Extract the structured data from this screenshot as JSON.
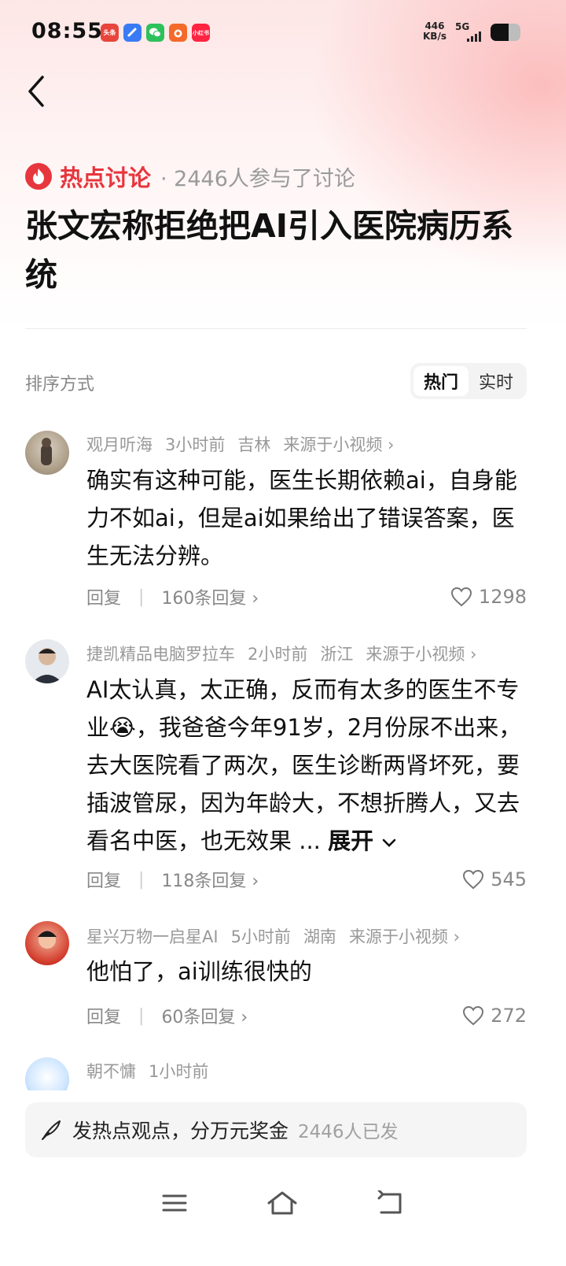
{
  "status": {
    "time": "08:55",
    "apps": [
      {
        "name": "toutiao-app-icon",
        "label": "头条",
        "color": "#e8453c"
      },
      {
        "name": "blue-app-icon",
        "label": "",
        "color": "#3a7bf5"
      },
      {
        "name": "wechat-icon",
        "label": "",
        "color": "#2dc15b"
      },
      {
        "name": "orange-app-icon",
        "label": "",
        "color": "#f46a2a"
      },
      {
        "name": "xiaohongshu-icon",
        "label": "小红书",
        "color": "#ff2442"
      }
    ],
    "net_speed_value": "446",
    "net_speed_unit": "KB/s",
    "network": "5G",
    "battery_level": 0.6
  },
  "header": {
    "topic_label": "热点讨论",
    "participant_text": "· 2446人参与了讨论",
    "title": "张文宏称拒绝把AI引入医院病历系统"
  },
  "sort": {
    "label": "排序方式",
    "options": [
      "热门",
      "实时"
    ],
    "active": "热门"
  },
  "comments": [
    {
      "user": "观月听海",
      "time": "3小时前",
      "location": "吉林",
      "source": "来源于小视频 ›",
      "text": "确实有这种可能，医生长期依赖ai，自身能力不如ai，但是ai如果给出了错误答案，医生无法分辨。",
      "reply_label": "回复",
      "replies": "160条回复 ›",
      "likes": "1298"
    },
    {
      "user": "捷凯精品电脑罗拉车",
      "time": "2小时前",
      "location": "浙江",
      "source": "来源于小视频 ›",
      "text": "AI太认真，太正确，反而有太多的医生不专业😭，我爸爸今年91岁，2月份尿不出来，去大医院看了两次，医生诊断两肾坏死，要插波管尿，因为年龄大，不想折腾人，又去看名中医，也无效果",
      "ellipsis": "...",
      "expand_label": "展开",
      "reply_label": "回复",
      "replies": "118条回复 ›",
      "likes": "545"
    },
    {
      "user": "星兴万物一启星AI",
      "time": "5小时前",
      "location": "湖南",
      "source": "来源于小视频 ›",
      "text": "他怕了，ai训练很快的",
      "reply_label": "回复",
      "replies": "60条回复 ›",
      "likes": "272"
    },
    {
      "user": "朝不慵",
      "time": "1小时前"
    }
  ],
  "composer": {
    "text": "发热点观点，分万元奖金",
    "count": "2446人已发"
  }
}
